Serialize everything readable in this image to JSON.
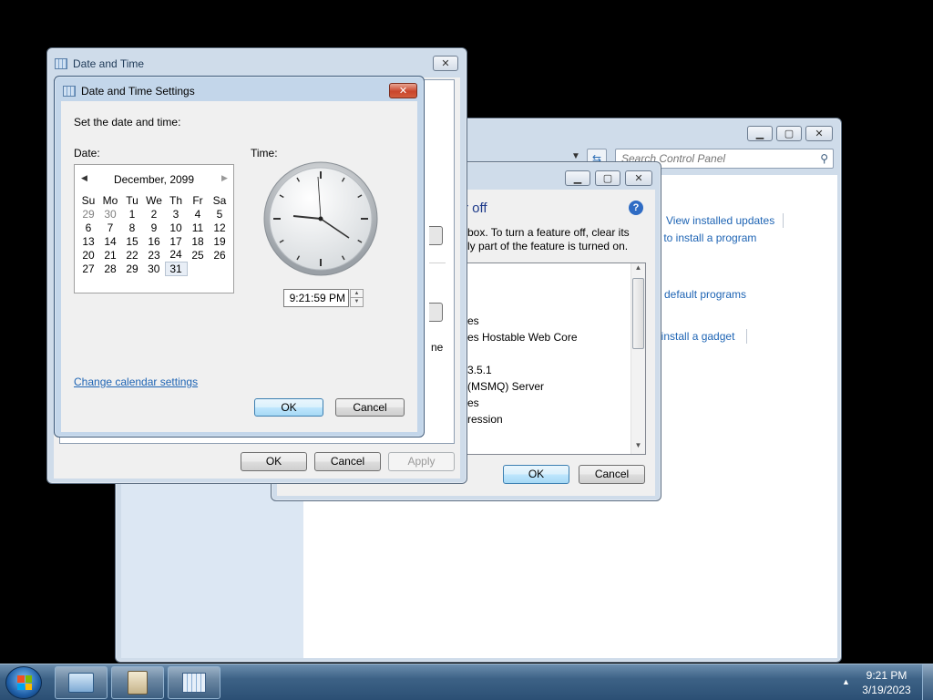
{
  "control_panel": {
    "search_placeholder": "Search Control Panel",
    "links": [
      "View installed updates",
      "y to install a program",
      "default programs",
      "ninstall a gadget"
    ]
  },
  "features_dialog": {
    "heading": "r off",
    "help_icon": "?",
    "description_line1": "box. To turn a feature off, clear its",
    "description_line2": "ly part of the feature is turned on.",
    "list_items": [
      "es",
      "es Hostable Web Core",
      "3.5.1",
      "(MSMQ) Server",
      "es",
      "ression"
    ],
    "ok": "OK",
    "cancel": "Cancel"
  },
  "date_time_window": {
    "title": "Date and Time",
    "partial_text": "ne",
    "ok": "OK",
    "cancel": "Cancel",
    "apply": "Apply"
  },
  "settings_dialog": {
    "title": "Date and Time Settings",
    "instruction": "Set the date and time:",
    "date_label": "Date:",
    "time_label": "Time:",
    "month_year": "December, 2099",
    "weekdays": [
      "Su",
      "Mo",
      "Tu",
      "We",
      "Th",
      "Fr",
      "Sa"
    ],
    "weeks": [
      [
        "29",
        "30",
        "1",
        "2",
        "3",
        "4",
        "5"
      ],
      [
        "6",
        "7",
        "8",
        "9",
        "10",
        "11",
        "12"
      ],
      [
        "13",
        "14",
        "15",
        "16",
        "17",
        "18",
        "19"
      ],
      [
        "20",
        "21",
        "22",
        "23",
        "24",
        "25",
        "26"
      ],
      [
        "27",
        "28",
        "29",
        "30",
        "31",
        "",
        ""
      ]
    ],
    "selected_day": "31",
    "time_value": "9:21:59 PM",
    "change_calendar_link": "Change calendar settings",
    "ok": "OK",
    "cancel": "Cancel"
  },
  "taskbar": {
    "clock_time": "9:21 PM",
    "clock_date": "3/19/2023",
    "tray_arrow": "▲",
    "items": [
      "control-panel",
      "programs-features",
      "date-time"
    ]
  }
}
